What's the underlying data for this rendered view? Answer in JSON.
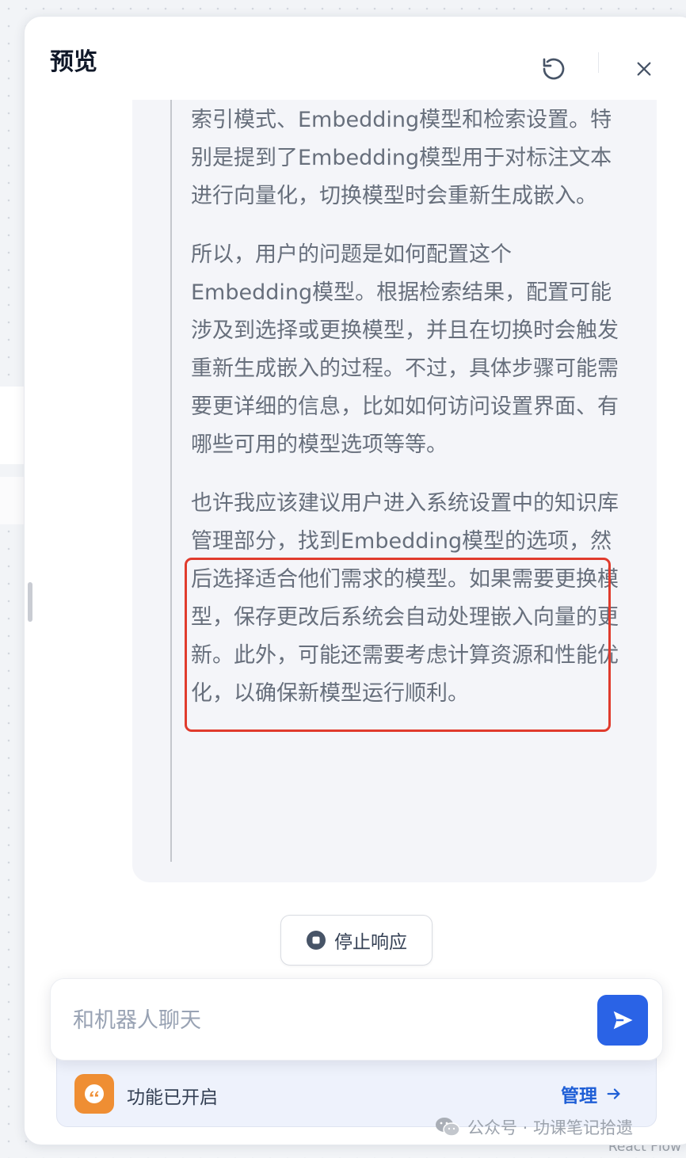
{
  "panel": {
    "title": "预览"
  },
  "background": {
    "corner_text": "React Flow"
  },
  "message": {
    "paragraphs": [
      "索引模式、Embedding模型和检索设置。特别是提到了Embedding模型用于对标注文本进行向量化，切换模型时会重新生成嵌入。",
      "所以，用户的问题是如何配置这个Embedding模型。根据检索结果，配置可能涉及到选择或更换模型，并且在切换时会触发重新生成嵌入的过程。不过，具体步骤可能需要更详细的信息，比如如何访问设置界面、有哪些可用的模型选项等等。",
      "也许我应该建议用户进入系统设置中的知识库管理部分，找到Embedding模型的选项，然后选择适合他们需求的模型。如果需要更换模型，保存更改后系统会自动处理嵌入向量的更新。此外，可能还需要考虑计算资源和性能优化，以确保新模型运行顺利。"
    ]
  },
  "stop_button": {
    "label": "停止响应",
    "icon": "stop-circle-icon"
  },
  "input": {
    "placeholder": "和机器人聊天",
    "value": ""
  },
  "feature_bar": {
    "text": "功能已开启",
    "manage_label": "管理",
    "icon": "quote-icon"
  },
  "watermark": {
    "text": "公众号 · 功课笔记拾遗"
  },
  "colors": {
    "accent": "#2a63e6",
    "highlight_border": "#e03b2d",
    "feature_icon_bg": "#ef8e33",
    "link": "#1f5fd6"
  }
}
